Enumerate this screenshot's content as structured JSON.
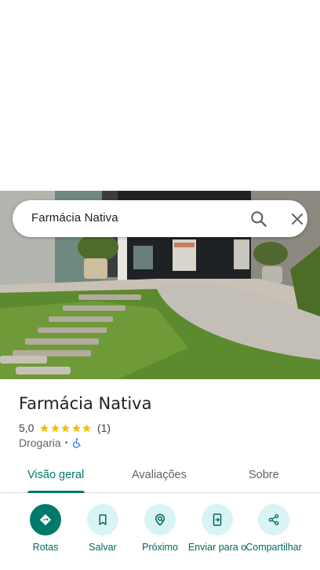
{
  "search": {
    "query": "Farmácia Nativa"
  },
  "place": {
    "name": "Farmácia Nativa",
    "rating": "5,0",
    "stars": 5,
    "review_count": "(1)",
    "category": "Drogaria",
    "separator": "•"
  },
  "tabs": [
    {
      "label": "Visão geral",
      "active": true
    },
    {
      "label": "Avaliações",
      "active": false
    },
    {
      "label": "Sobre",
      "active": false
    }
  ],
  "actions": [
    {
      "label": "Rotas",
      "icon": "directions-icon"
    },
    {
      "label": "Salvar",
      "icon": "bookmark-icon"
    },
    {
      "label": "Próximo",
      "icon": "nearby-icon"
    },
    {
      "label": "Enviar para o",
      "icon": "send-to-phone-icon"
    },
    {
      "label": "Compartilhar",
      "icon": "share-icon"
    }
  ],
  "colors": {
    "accent": "#00796b",
    "action_bg": "#d9f4f4",
    "star": "#fbbc04",
    "accessible": "#1a73e8"
  }
}
